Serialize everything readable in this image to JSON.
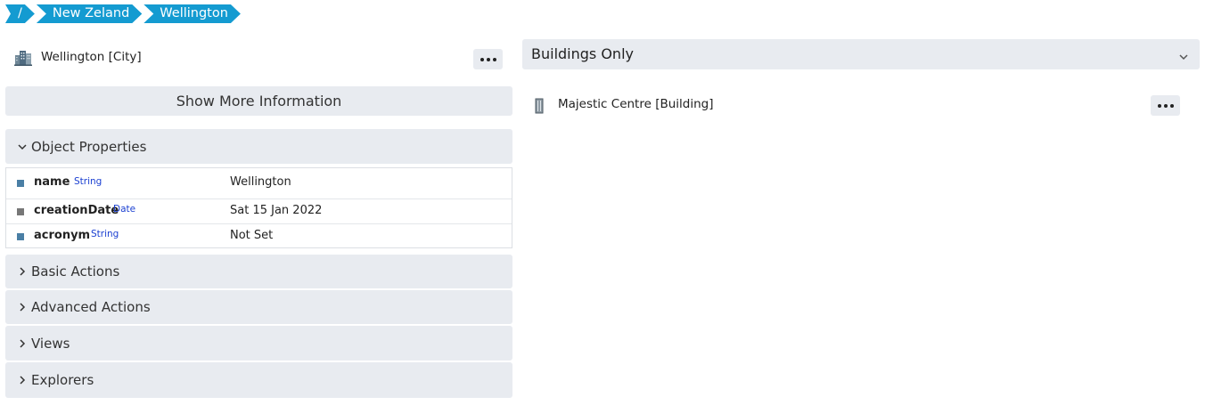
{
  "breadcrumb": [
    {
      "label": "/"
    },
    {
      "label": "New Zeland"
    },
    {
      "label": "Wellington"
    }
  ],
  "object": {
    "title": "Wellington [City]",
    "icon": "city-buildings-icon"
  },
  "show_more_label": "Show More Information",
  "sections": {
    "object_properties": "Object Properties",
    "basic_actions": "Basic Actions",
    "advanced_actions": "Advanced Actions",
    "views": "Views",
    "explorers": "Explorers"
  },
  "properties": [
    {
      "name": "name",
      "type": "String",
      "value": "Wellington",
      "color": "#4a7fa5"
    },
    {
      "name": "creationDate",
      "type": "Date",
      "value": "Sat 15 Jan 2022",
      "color": "#777777"
    },
    {
      "name": "acronym",
      "type": "String",
      "value": "Not Set",
      "color": "#4a7fa5"
    }
  ],
  "right_panel": {
    "title": "Buildings Only",
    "items": [
      {
        "title": "Majestic Centre [Building]",
        "icon": "tower-building-icon"
      }
    ]
  },
  "colors": {
    "accent": "#149bd1",
    "panel_bg": "#e8ebf0",
    "type_label": "#1a3fd1"
  }
}
